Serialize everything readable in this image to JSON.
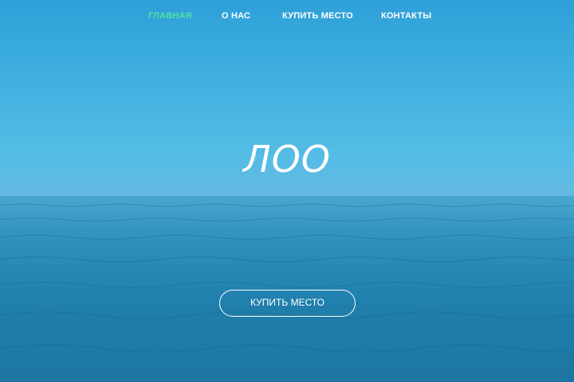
{
  "nav": {
    "items": [
      {
        "label": "ГЛАВНАЯ",
        "active": true
      },
      {
        "label": "О НАС",
        "active": false
      },
      {
        "label": "КУПИТЬ МЕСТО",
        "active": false
      },
      {
        "label": "КОНТАКТЫ",
        "active": false
      }
    ]
  },
  "hero": {
    "logo_text": "ЛОО",
    "cta_label": "КУПИТЬ МЕСТО"
  },
  "colors": {
    "active_nav": "#4fe0a4",
    "sky": "#40b0e0",
    "sea": "#1f7eab",
    "text": "#ffffff"
  }
}
